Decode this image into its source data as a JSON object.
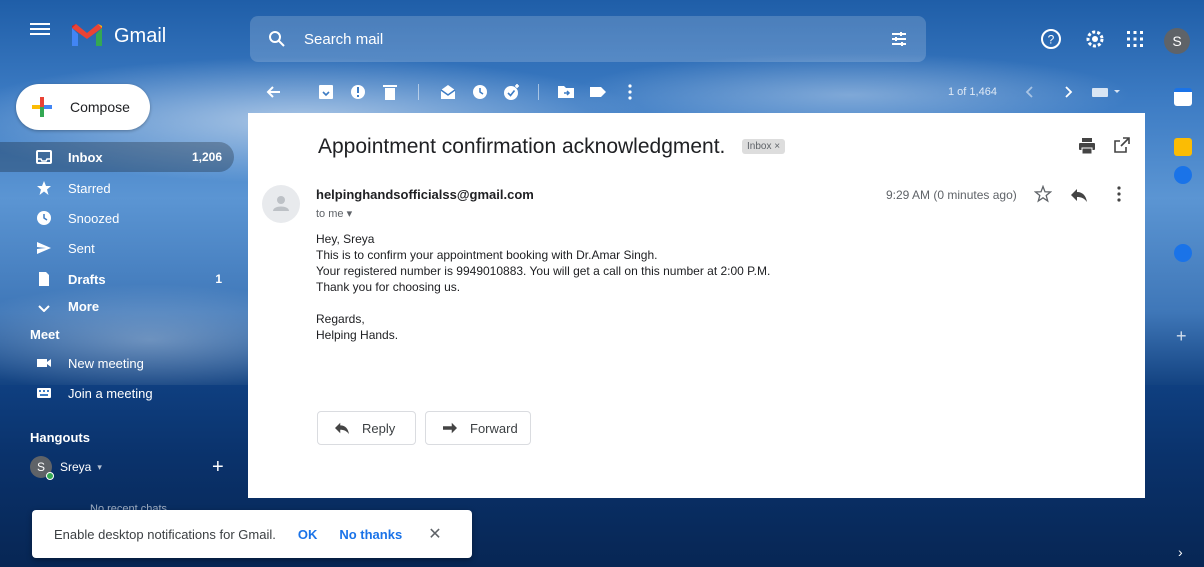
{
  "header": {
    "app_name": "Gmail",
    "search_placeholder": "Search mail",
    "avatar_initial": "S",
    "icons": [
      "menu-icon",
      "gmail-logo-icon",
      "search-icon",
      "tune-icon",
      "help-icon",
      "settings-icon",
      "apps-icon"
    ]
  },
  "sidebar": {
    "compose_label": "Compose",
    "items": [
      {
        "label": "Inbox",
        "count": "1,206",
        "icon": "inbox-icon"
      },
      {
        "label": "Starred",
        "count": "",
        "icon": "star-icon"
      },
      {
        "label": "Snoozed",
        "count": "",
        "icon": "clock-icon"
      },
      {
        "label": "Sent",
        "count": "",
        "icon": "send-icon"
      },
      {
        "label": "Drafts",
        "count": "1",
        "icon": "draft-icon"
      },
      {
        "label": "More",
        "count": "",
        "icon": "chevron-down-icon"
      }
    ],
    "meet_title": "Meet",
    "meet_items": [
      {
        "label": "New meeting",
        "icon": "video-icon"
      },
      {
        "label": "Join a meeting",
        "icon": "keyboard-icon"
      }
    ],
    "hangouts_title": "Hangouts",
    "hangouts_user": "Sreya",
    "hangouts_initial": "S",
    "no_recent_chats": "No recent chats"
  },
  "toolbar": {
    "pager": "1 of 1,464",
    "icons": [
      "back-arrow-icon",
      "archive-icon",
      "report-spam-icon",
      "delete-icon",
      "mark-unread-icon",
      "snooze-icon",
      "add-task-icon",
      "move-to-icon",
      "label-icon",
      "more-vert-icon",
      "prev-icon",
      "next-icon",
      "keyboard-icon"
    ]
  },
  "email": {
    "subject": "Appointment confirmation acknowledgment.",
    "label_chip": "Inbox ×",
    "sender": "helpinghandsofficialss@gmail.com",
    "to": "to me ▾",
    "time": "9:29 AM (0 minutes ago)",
    "body": [
      "Hey, Sreya",
      "This is to confirm your appointment booking with Dr.Amar Singh.",
      "Your registered number is 9949010883. You will get a call on this number at 2:00 P.M.",
      "Thank you for choosing us."
    ],
    "signoff": [
      "Regards,",
      "Helping Hands."
    ],
    "reply_label": "Reply",
    "forward_label": "Forward"
  },
  "toast": {
    "message": "Enable desktop notifications for Gmail.",
    "ok": "OK",
    "no_thanks": "No thanks",
    "close": "✕"
  },
  "colors": {
    "accent": "#1a73e8",
    "gmail_red": "#ea4335",
    "compose_plus": [
      "#ea4335",
      "#fbbc04",
      "#34a853",
      "#4285f4"
    ]
  }
}
